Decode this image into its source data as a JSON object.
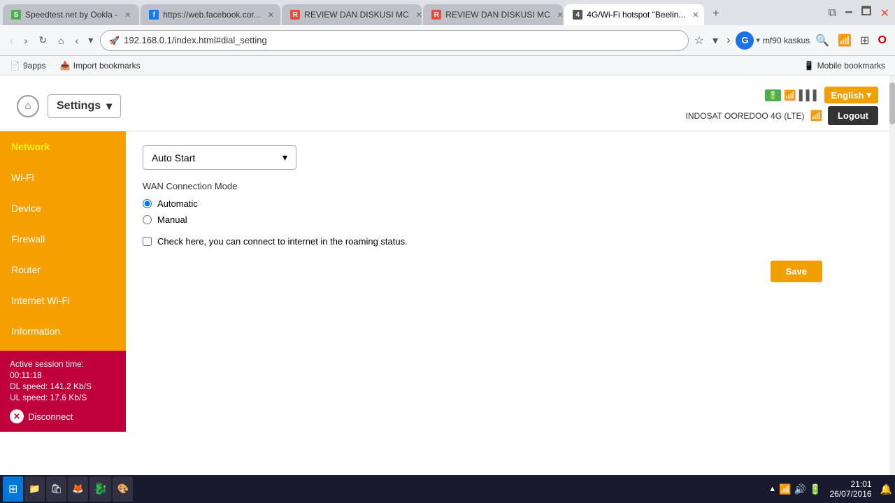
{
  "browser": {
    "tabs": [
      {
        "id": "tab1",
        "title": "Speedtest.net by Ookla -",
        "favicon": "S",
        "active": false,
        "color": "#4caf50"
      },
      {
        "id": "tab2",
        "title": "https://web.facebook.cor...",
        "favicon": "f",
        "active": false,
        "color": "#1877f2"
      },
      {
        "id": "tab3",
        "title": "REVIEW DAN DISKUSI MC",
        "favicon": "R",
        "active": false,
        "color": "#e74c3c"
      },
      {
        "id": "tab4",
        "title": "REVIEW DAN DISKUSI MC",
        "favicon": "R",
        "active": false,
        "color": "#e74c3c"
      },
      {
        "id": "tab5",
        "title": "4G/Wi-Fi hotspot \"Beelin...",
        "favicon": "4",
        "active": true,
        "color": "#555"
      }
    ],
    "address": "192.168.0.1/index.html#dial_setting",
    "zoom": "100%",
    "profile": "mf90 kaskus"
  },
  "bookmarks": {
    "items": [
      {
        "label": "9apps"
      },
      {
        "label": "Import bookmarks"
      },
      {
        "label": "Mobile bookmarks"
      }
    ]
  },
  "router": {
    "header": {
      "settings_label": "Settings",
      "english_label": "English",
      "logout_label": "Logout",
      "operator": "INDOSAT OOREDOO 4G (LTE)"
    },
    "sidebar": {
      "items": [
        {
          "label": "Network",
          "active": true
        },
        {
          "label": "Wi-Fi",
          "active": false
        },
        {
          "label": "Device",
          "active": false
        },
        {
          "label": "Firewall",
          "active": false
        },
        {
          "label": "Router",
          "active": false
        },
        {
          "label": "Internet Wi-Fi",
          "active": false
        },
        {
          "label": "Information",
          "active": false
        }
      ],
      "session": {
        "title": "Active session time:",
        "time": "00:11:18",
        "dl_label": "DL speed:",
        "dl_value": "141.2 Kb/S",
        "ul_label": "UL speed:",
        "ul_value": "17.6 Kb/S"
      },
      "disconnect_label": "Disconnect"
    },
    "content": {
      "wan_mode": "Auto Start",
      "wan_mode_label": "WAN Connection Mode",
      "automatic_label": "Automatic",
      "manual_label": "Manual",
      "roaming_label": "Check here, you can connect to internet in the roaming status.",
      "save_label": "Save"
    }
  },
  "taskbar": {
    "clock_time": "21:01",
    "clock_date": "26/07/2016",
    "zoom": "100%",
    "apps": [
      "📁",
      "🛍",
      "🦊",
      "🐉",
      "🎨"
    ]
  }
}
